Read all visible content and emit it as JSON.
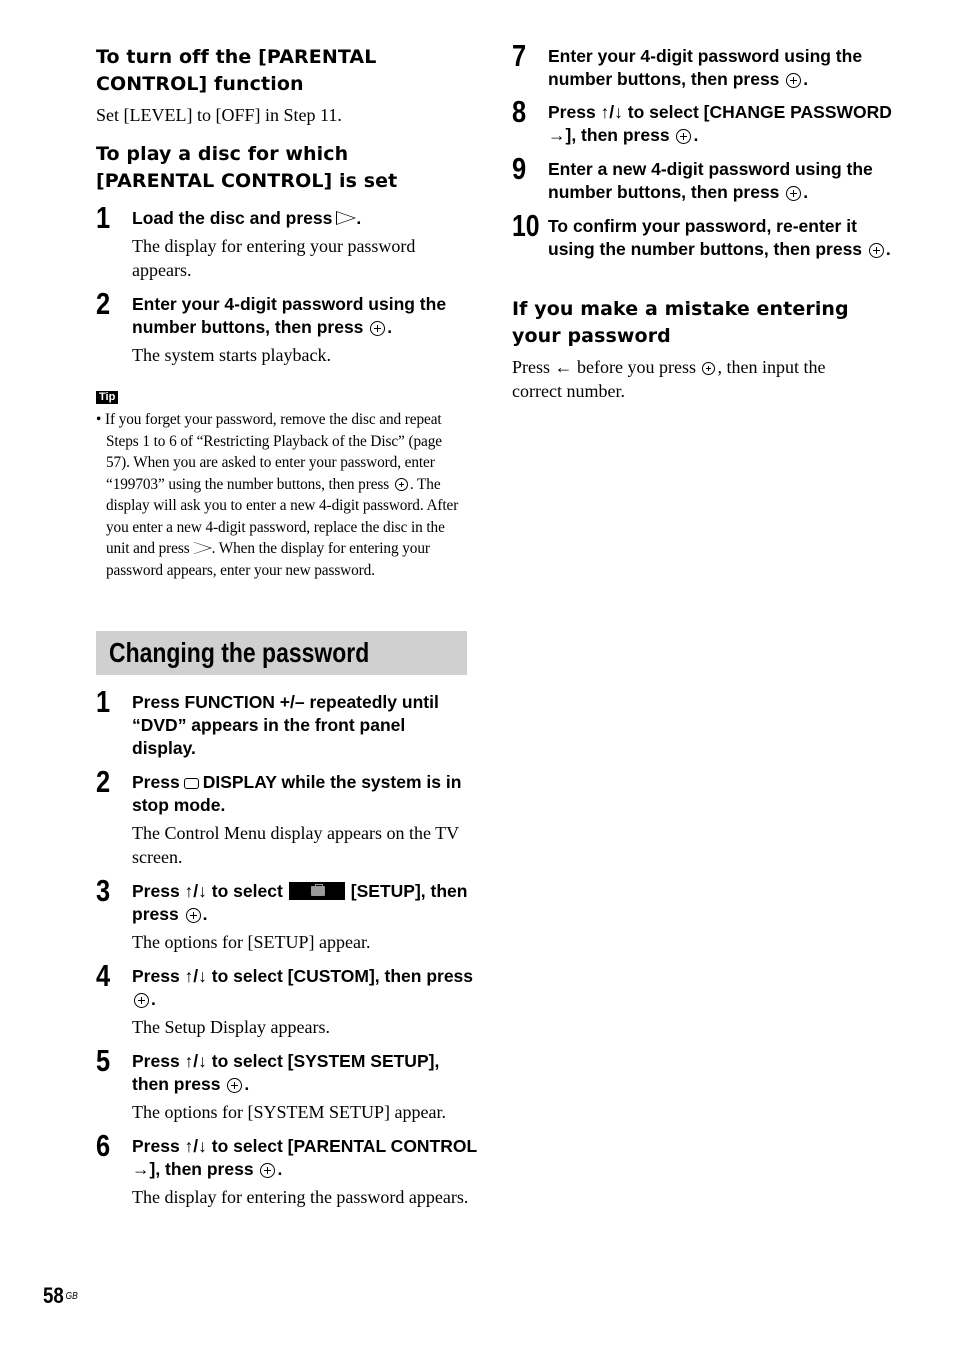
{
  "left": {
    "turn_off": {
      "heading_line1": "To turn off the [PARENTAL",
      "heading_line2": "CONTROL] function",
      "text": "Set [LEVEL] to [OFF] in Step 11."
    },
    "play_disc": {
      "heading_line1": "To play a disc for which",
      "heading_line2": "[PARENTAL CONTROL] is set",
      "steps": [
        {
          "num": "1",
          "title_a": "Load the disc and press",
          "title_b": ".",
          "desc": "The display for entering your password appears."
        },
        {
          "num": "2",
          "title_a": "Enter your 4-digit password using the number buttons, then press",
          "title_b": ".",
          "desc": "The system starts playback."
        }
      ]
    },
    "tip": {
      "badge": "Tip",
      "text_a": "• If you forget your password, remove the disc and repeat Steps 1 to 6 of “Restricting Playback of the Disc” (page 57). When you are asked to enter your password, enter “199703” using the number buttons, then press",
      "text_b": ". The display will ask you to enter a new 4-digit password. After you enter a new 4-digit password, replace the disc in the unit and press",
      "text_c": ". When the display for entering your password appears, enter your new password."
    },
    "section_title": "Changing the password",
    "steps": [
      {
        "num": "1",
        "title": "Press FUNCTION +/– repeatedly until “DVD” appears in the front panel display."
      },
      {
        "num": "2",
        "title_a": "Press",
        "title_b": "DISPLAY while the system is in stop mode.",
        "desc": "The Control Menu display appears on the TV screen."
      },
      {
        "num": "3",
        "title_a": "Press ↑/↓ to select",
        "title_b": "[SETUP], then press",
        "title_c": ".",
        "desc": "The options for [SETUP] appear."
      },
      {
        "num": "4",
        "title_a": "Press ↑/↓ to select [CUSTOM], then press",
        "title_b": ".",
        "desc": "The Setup Display appears."
      },
      {
        "num": "5",
        "title_a": "Press ↑/↓ to select [SYSTEM SETUP], then press",
        "title_b": ".",
        "desc": "The options for [SYSTEM SETUP] appear."
      },
      {
        "num": "6",
        "title_a": "Press ↑/↓ to select [PARENTAL CONTROL →], then press",
        "title_b": ".",
        "desc": "The display for entering the password appears."
      }
    ]
  },
  "right": {
    "steps": [
      {
        "num": "7",
        "title_a": "Enter your 4-digit password using the number buttons, then press",
        "title_b": "."
      },
      {
        "num": "8",
        "title_a": "Press ↑/↓ to select [CHANGE PASSWORD →], then press",
        "title_b": "."
      },
      {
        "num": "9",
        "title_a": "Enter a new 4-digit password using the number buttons, then press",
        "title_b": "."
      },
      {
        "num": "10",
        "title_a": "To confirm your password, re-enter it using the number buttons, then press",
        "title_b": "."
      }
    ],
    "mistake": {
      "heading_line1": "If you make a mistake entering",
      "heading_line2": "your password",
      "text_a": "Press ← before you press",
      "text_b": ", then input the correct number."
    }
  },
  "footer": {
    "page_number": "58",
    "region": "GB"
  }
}
